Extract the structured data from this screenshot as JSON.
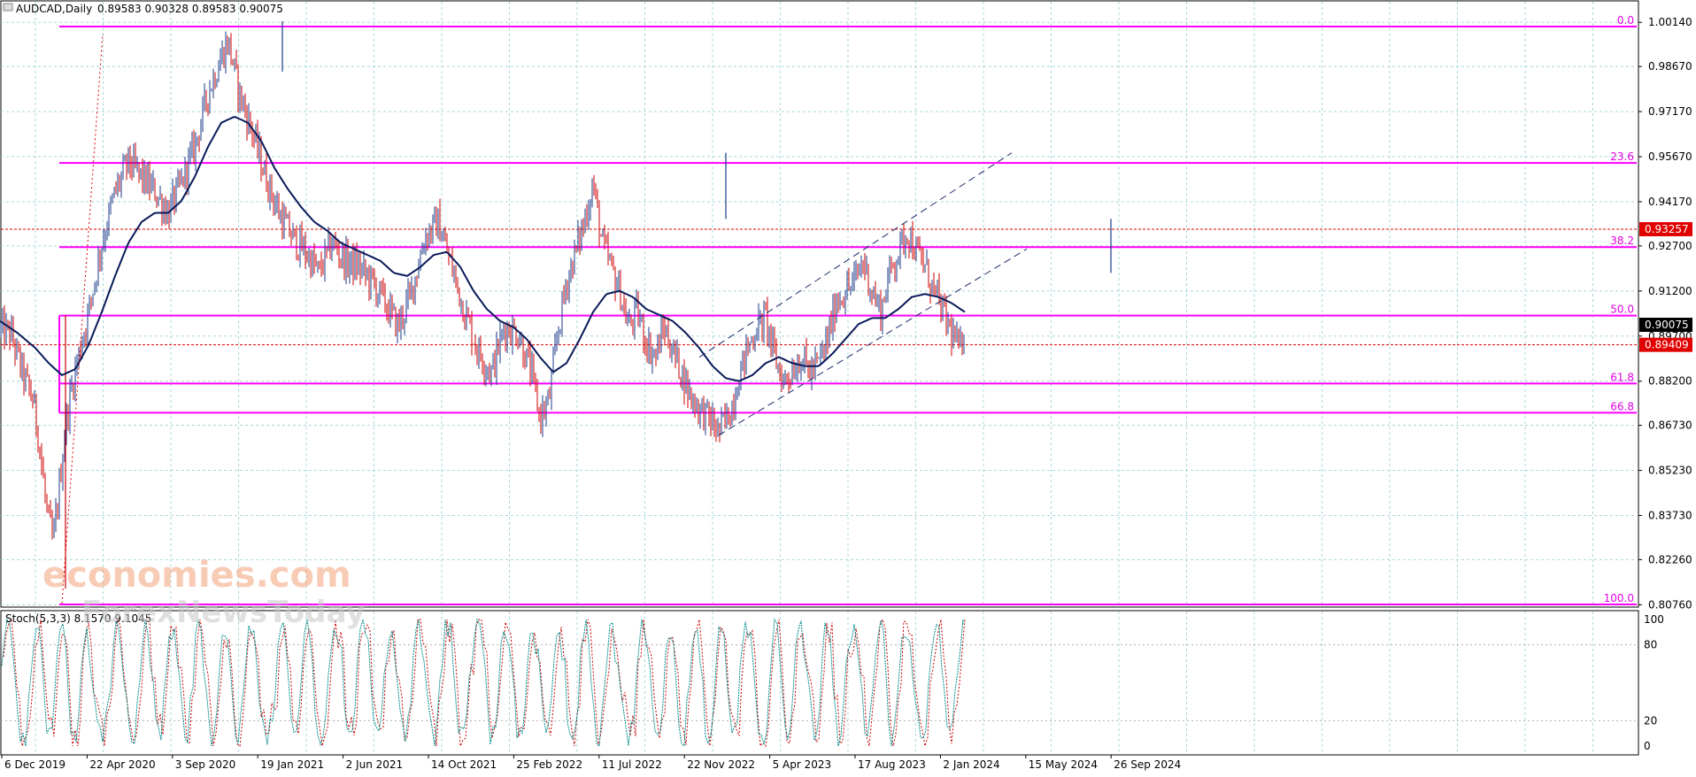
{
  "header": {
    "symbol": "AUDCAD,Daily",
    "ohlc": "0.89583 0.90328 0.89583 0.90075"
  },
  "stoch_label": "Stoch(5,3,3) 8.1570 9.1045",
  "watermark": {
    "line1": "economies.com",
    "line2": "ForexNewsToday"
  },
  "colors": {
    "fib_line": "#ff00ff",
    "grid": "#a8d8d8",
    "bull_candle": "#1a3a8a",
    "bear_candle": "#cc0000",
    "ma_line": "#0a1a5a",
    "price_tag_red": "#e00000",
    "price_tag_black": "#000000",
    "stoch_main": "#008b8b",
    "stoch_signal": "#cc0000"
  },
  "chart_data": {
    "type": "candlestick",
    "title": "AUDCAD,Daily",
    "x_ticks": [
      "6 Dec 2019",
      "22 Apr 2020",
      "3 Sep 2020",
      "19 Jan 2021",
      "2 Jun 2021",
      "14 Oct 2021",
      "25 Feb 2022",
      "11 Jul 2022",
      "22 Nov 2022",
      "5 Apr 2023",
      "17 Aug 2023",
      "2 Jan 2024",
      "15 May 2024",
      "26 Sep 2024"
    ],
    "y_ticks": [
      "1.00140",
      "0.98670",
      "0.97170",
      "0.95670",
      "0.94170",
      "0.92700",
      "0.91200",
      "0.89700",
      "0.88200",
      "0.86730",
      "0.85230",
      "0.83730",
      "0.82260",
      "0.80760"
    ],
    "ylim": [
      0.8033,
      1.0057
    ],
    "fib_levels": [
      {
        "label": "0.0",
        "price": 1.0
      },
      {
        "label": "23.6",
        "price": 0.9546
      },
      {
        "label": "38.2",
        "price": 0.9266
      },
      {
        "label": "50.0",
        "price": 0.9038
      },
      {
        "label": "61.8",
        "price": 0.8812
      },
      {
        "label": "66.8",
        "price": 0.8715
      },
      {
        "label": "100.0",
        "price": 0.8077
      }
    ],
    "price_tags": [
      {
        "text": "0.93257",
        "price": 0.93257,
        "style": "red"
      },
      {
        "text": "0.90075",
        "price": 0.90075,
        "style": "black"
      },
      {
        "text": "0.89409",
        "price": 0.89409,
        "style": "red"
      }
    ],
    "close_path": [
      [
        0,
        0.899
      ],
      [
        12,
        0.898
      ],
      [
        25,
        0.885
      ],
      [
        38,
        0.875
      ],
      [
        45,
        0.86
      ],
      [
        52,
        0.84
      ],
      [
        60,
        0.828
      ],
      [
        68,
        0.85
      ],
      [
        75,
        0.87
      ],
      [
        85,
        0.886
      ],
      [
        100,
        0.905
      ],
      [
        115,
        0.928
      ],
      [
        130,
        0.945
      ],
      [
        145,
        0.955
      ],
      [
        160,
        0.95
      ],
      [
        175,
        0.945
      ],
      [
        190,
        0.938
      ],
      [
        205,
        0.948
      ],
      [
        220,
        0.96
      ],
      [
        235,
        0.978
      ],
      [
        250,
        0.99
      ],
      [
        258,
        0.995
      ],
      [
        270,
        0.978
      ],
      [
        285,
        0.965
      ],
      [
        300,
        0.95
      ],
      [
        315,
        0.938
      ],
      [
        330,
        0.93
      ],
      [
        345,
        0.925
      ],
      [
        360,
        0.918
      ],
      [
        375,
        0.928
      ],
      [
        390,
        0.922
      ],
      [
        405,
        0.92
      ],
      [
        420,
        0.915
      ],
      [
        435,
        0.908
      ],
      [
        450,
        0.9
      ],
      [
        465,
        0.912
      ],
      [
        480,
        0.93
      ],
      [
        495,
        0.935
      ],
      [
        510,
        0.92
      ],
      [
        525,
        0.905
      ],
      [
        540,
        0.892
      ],
      [
        555,
        0.885
      ],
      [
        570,
        0.9
      ],
      [
        585,
        0.898
      ],
      [
        600,
        0.885
      ],
      [
        610,
        0.87
      ],
      [
        620,
        0.875
      ],
      [
        630,
        0.898
      ],
      [
        640,
        0.915
      ],
      [
        650,
        0.925
      ],
      [
        660,
        0.935
      ],
      [
        670,
        0.948
      ],
      [
        680,
        0.928
      ],
      [
        690,
        0.92
      ],
      [
        700,
        0.912
      ],
      [
        710,
        0.9
      ],
      [
        720,
        0.905
      ],
      [
        730,
        0.895
      ],
      [
        740,
        0.89
      ],
      [
        750,
        0.9
      ],
      [
        760,
        0.892
      ],
      [
        770,
        0.885
      ],
      [
        780,
        0.877
      ],
      [
        790,
        0.873
      ],
      [
        800,
        0.87
      ],
      [
        812,
        0.865
      ],
      [
        825,
        0.872
      ],
      [
        835,
        0.884
      ],
      [
        845,
        0.893
      ],
      [
        855,
        0.9
      ],
      [
        865,
        0.903
      ],
      [
        875,
        0.89
      ],
      [
        885,
        0.882
      ],
      [
        895,
        0.886
      ],
      [
        905,
        0.89
      ],
      [
        915,
        0.885
      ],
      [
        925,
        0.888
      ],
      [
        935,
        0.896
      ],
      [
        945,
        0.909
      ],
      [
        955,
        0.912
      ],
      [
        965,
        0.915
      ],
      [
        975,
        0.922
      ],
      [
        985,
        0.912
      ],
      [
        995,
        0.905
      ],
      [
        1005,
        0.918
      ],
      [
        1015,
        0.925
      ],
      [
        1025,
        0.932
      ],
      [
        1035,
        0.925
      ],
      [
        1045,
        0.92
      ],
      [
        1055,
        0.912
      ],
      [
        1065,
        0.905
      ],
      [
        1075,
        0.898
      ],
      [
        1085,
        0.892
      ],
      [
        1090,
        0.9007
      ]
    ],
    "ma_path": [
      [
        0,
        0.902
      ],
      [
        20,
        0.898
      ],
      [
        40,
        0.893
      ],
      [
        55,
        0.888
      ],
      [
        70,
        0.884
      ],
      [
        85,
        0.886
      ],
      [
        100,
        0.894
      ],
      [
        115,
        0.905
      ],
      [
        130,
        0.917
      ],
      [
        145,
        0.928
      ],
      [
        160,
        0.935
      ],
      [
        175,
        0.938
      ],
      [
        190,
        0.938
      ],
      [
        205,
        0.942
      ],
      [
        220,
        0.95
      ],
      [
        235,
        0.96
      ],
      [
        250,
        0.968
      ],
      [
        265,
        0.97
      ],
      [
        280,
        0.968
      ],
      [
        295,
        0.962
      ],
      [
        310,
        0.953
      ],
      [
        325,
        0.946
      ],
      [
        340,
        0.94
      ],
      [
        355,
        0.935
      ],
      [
        370,
        0.932
      ],
      [
        385,
        0.928
      ],
      [
        400,
        0.926
      ],
      [
        415,
        0.924
      ],
      [
        430,
        0.922
      ],
      [
        445,
        0.918
      ],
      [
        460,
        0.917
      ],
      [
        475,
        0.92
      ],
      [
        490,
        0.924
      ],
      [
        505,
        0.925
      ],
      [
        520,
        0.92
      ],
      [
        535,
        0.912
      ],
      [
        550,
        0.906
      ],
      [
        565,
        0.902
      ],
      [
        580,
        0.9
      ],
      [
        595,
        0.896
      ],
      [
        610,
        0.89
      ],
      [
        625,
        0.885
      ],
      [
        640,
        0.888
      ],
      [
        655,
        0.896
      ],
      [
        670,
        0.905
      ],
      [
        685,
        0.911
      ],
      [
        700,
        0.912
      ],
      [
        715,
        0.91
      ],
      [
        730,
        0.906
      ],
      [
        745,
        0.904
      ],
      [
        760,
        0.902
      ],
      [
        775,
        0.898
      ],
      [
        790,
        0.893
      ],
      [
        805,
        0.887
      ],
      [
        820,
        0.883
      ],
      [
        835,
        0.882
      ],
      [
        850,
        0.884
      ],
      [
        865,
        0.888
      ],
      [
        880,
        0.89
      ],
      [
        895,
        0.888
      ],
      [
        910,
        0.887
      ],
      [
        925,
        0.887
      ],
      [
        940,
        0.891
      ],
      [
        955,
        0.896
      ],
      [
        970,
        0.901
      ],
      [
        985,
        0.903
      ],
      [
        1000,
        0.903
      ],
      [
        1015,
        0.906
      ],
      [
        1030,
        0.91
      ],
      [
        1045,
        0.911
      ],
      [
        1060,
        0.91
      ],
      [
        1075,
        0.908
      ],
      [
        1090,
        0.905
      ]
    ],
    "channel_lines": [
      {
        "x1": 812,
        "p1": 0.864,
        "x2": 1160,
        "p2": 0.926
      },
      {
        "x1": 790,
        "p1": 0.89,
        "x2": 1143,
        "p2": 0.958
      }
    ],
    "stoch_y_ticks": [
      "100",
      "80",
      "20",
      "0"
    ]
  }
}
